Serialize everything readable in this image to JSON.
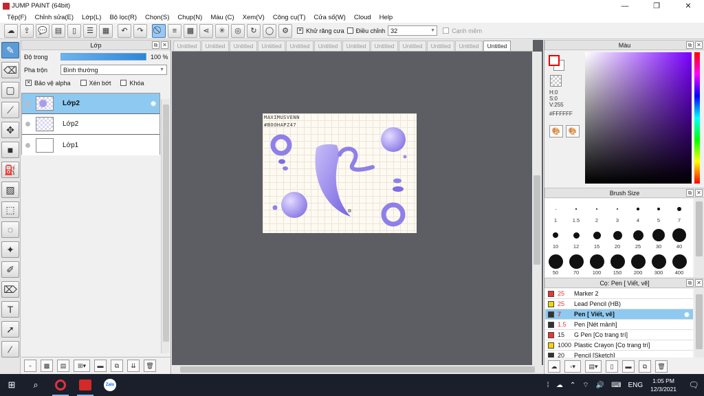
{
  "window": {
    "title": "JUMP PAINT (64bit)",
    "minimize": "—",
    "maximize": "❐",
    "close": "✕"
  },
  "menu": [
    "Tệp(F)",
    "Chỉnh sửa(E)",
    "Lớp(L)",
    "Bộ lọc(R)",
    "Chọn(S)",
    "Chụp(N)",
    "Màu (C)",
    "Xem(V)",
    "Công cụ(T)",
    "Cửa số(W)",
    "Cloud",
    "Help"
  ],
  "toolbar": {
    "antialias_label": "Khử răng cưa",
    "adjust_label": "Điều chỉnh",
    "brush_size_value": "32",
    "smooth_label": "Cạnh mềm"
  },
  "layer_panel": {
    "title": "Lớp",
    "opacity_label": "Độ trong",
    "opacity_value": "100 %",
    "opacity_fraction": 1.0,
    "blend_label": "Pha trộn",
    "blend_value": "Bình thường",
    "protect_alpha": "Bảo vệ alpha",
    "clipping": "Xén bớt",
    "lock": "Khóa",
    "layers": [
      {
        "name": "Lớp2",
        "selected": true
      },
      {
        "name": "Lớp2",
        "selected": false
      },
      {
        "name": "Lớp1",
        "selected": false
      }
    ]
  },
  "document_tabs": [
    "Untitled",
    "Untitled",
    "Untitled",
    "Untitled",
    "Untitled",
    "Untitled",
    "Untitled",
    "Untitled",
    "Untitled",
    "Untitled",
    "Untitled",
    "Untitled"
  ],
  "active_tab_index": 11,
  "artwork": {
    "line1": "MAXIMUSVENN",
    "line2": "#BOOHAPZ47"
  },
  "color_panel": {
    "title": "Màu",
    "h": "H:0",
    "s": "S:0",
    "v": "V:255",
    "hex": "#FFFFFF",
    "accent": "#7a00ff"
  },
  "brush_size_panel": {
    "title": "Brush Size",
    "sizes": [
      "1",
      "1.5",
      "2",
      "3",
      "4",
      "5",
      "7",
      "10",
      "12",
      "15",
      "20",
      "25",
      "30",
      "40",
      "50",
      "70",
      "100",
      "150",
      "200",
      "300",
      "400"
    ]
  },
  "brushes_panel": {
    "title": "Cọ: Pen [ Viết, vẽ]",
    "items": [
      {
        "size": "25",
        "name": "Marker 2",
        "color": "#e53935",
        "size_color": "#e53935",
        "selected": false
      },
      {
        "size": "25",
        "name": "Lead Pencil (HB)",
        "color": "#f2d600",
        "size_color": "#e53935",
        "selected": false
      },
      {
        "size": "7",
        "name": "Pen [ Viết, vẽ]",
        "color": "#333333",
        "size_color": "#e53935",
        "selected": true
      },
      {
        "size": "1.5",
        "name": "Pen [Nét mảnh]",
        "color": "#333333",
        "size_color": "#e53935",
        "selected": false
      },
      {
        "size": "15",
        "name": "G Pen [Cọ trang trí]",
        "color": "#e53935",
        "size_color": "#222222",
        "selected": false
      },
      {
        "size": "1000",
        "name": "Plastic Crayon [Cọ trang trí]",
        "color": "#f2d600",
        "size_color": "#222222",
        "selected": false
      },
      {
        "size": "20",
        "name": "Pencil [Sketch]",
        "color": "#333333",
        "size_color": "#222222",
        "selected": false
      }
    ]
  },
  "taskbar": {
    "keyboard": "ENG",
    "time": "1:05 PM",
    "date": "12/3/2021",
    "app_badge": "Zalo"
  }
}
